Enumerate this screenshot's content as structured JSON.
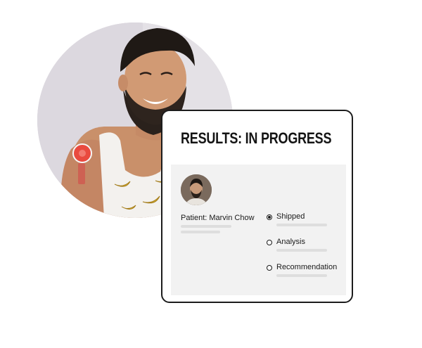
{
  "photo": {
    "subject": "smiling bearded man wearing a sensor patch on upper arm"
  },
  "card": {
    "title": "RESULTS: IN PROGRESS",
    "patient": {
      "label": "Patient: Marvin Chow"
    },
    "statuses": [
      {
        "label": "Shipped",
        "selected": true
      },
      {
        "label": "Analysis",
        "selected": false
      },
      {
        "label": "Recommendation",
        "selected": false
      }
    ]
  },
  "colors": {
    "border": "#1c1c1c",
    "panel": "#f2f2f2",
    "placeholder": "#dedede",
    "sensor": "#e94a3f"
  }
}
